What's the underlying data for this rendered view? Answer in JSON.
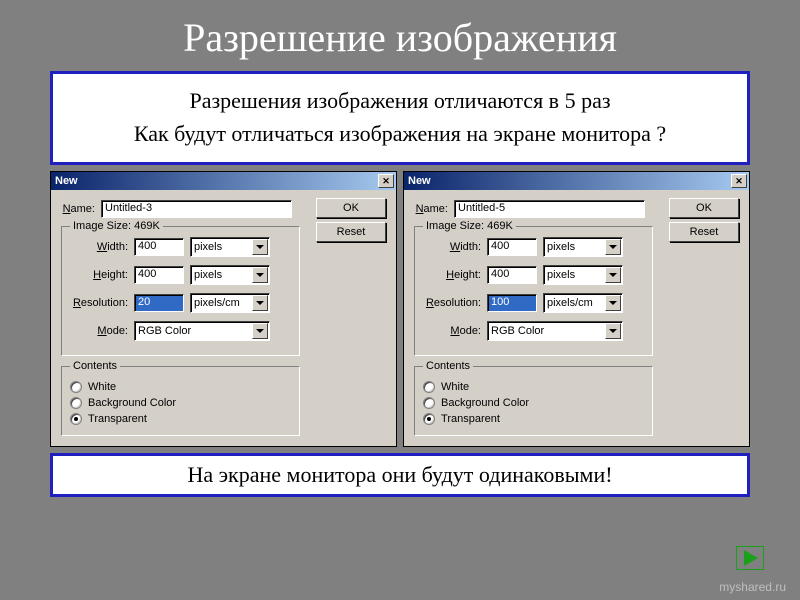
{
  "slide": {
    "title": "Разрешение изображения",
    "question_line1": "Разрешения изображения отличаются в 5 раз",
    "question_line2": "Как будут отличаться изображения на экране монитора ?",
    "answer": "На экране монитора они будут одинаковыми!",
    "watermark": "myshared.ru"
  },
  "dialogs": [
    {
      "title": "New",
      "name_label": "Name:",
      "name_value": "Untitled-3",
      "ok": "OK",
      "reset": "Reset",
      "image_size_legend": "Image Size:  469K",
      "width_label": "Width:",
      "width_value": "400",
      "width_unit": "pixels",
      "height_label": "Height:",
      "height_value": "400",
      "height_unit": "pixels",
      "res_label": "Resolution:",
      "res_value": "20",
      "res_unit": "pixels/cm",
      "mode_label": "Mode:",
      "mode_value": "RGB Color",
      "contents_legend": "Contents",
      "opt_white": "White",
      "opt_bg": "Background Color",
      "opt_trans": "Transparent",
      "selected": "trans"
    },
    {
      "title": "New",
      "name_label": "Name:",
      "name_value": "Untitled-5",
      "ok": "OK",
      "reset": "Reset",
      "image_size_legend": "Image Size:  469K",
      "width_label": "Width:",
      "width_value": "400",
      "width_unit": "pixels",
      "height_label": "Height:",
      "height_value": "400",
      "height_unit": "pixels",
      "res_label": "Resolution:",
      "res_value": "100",
      "res_unit": "pixels/cm",
      "mode_label": "Mode:",
      "mode_value": "RGB Color",
      "contents_legend": "Contents",
      "opt_white": "White",
      "opt_bg": "Background Color",
      "opt_trans": "Transparent",
      "selected": "trans"
    }
  ]
}
